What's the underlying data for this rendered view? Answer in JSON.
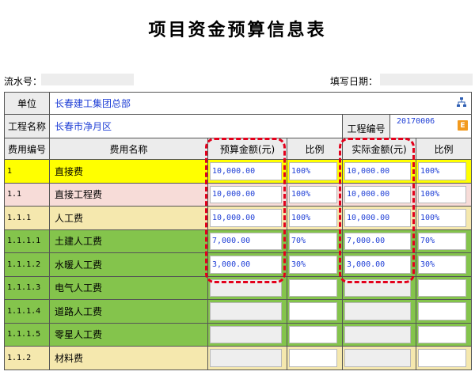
{
  "title": "项目资金预算信息表",
  "meta": {
    "serial_label": "流水号：",
    "serial_value": "",
    "date_label": "填写日期：",
    "date_value": ""
  },
  "unit_row": {
    "label": "单位",
    "value": "长春建工集团总部"
  },
  "project_row": {
    "name_label": "工程名称",
    "name_value": "长春市净月区",
    "code_label": "工程编号",
    "code_value": "20170006"
  },
  "columns": {
    "code": "费用编号",
    "name": "费用名称",
    "budget": "预算金额(元)",
    "budget_ratio": "比例",
    "actual": "实际金额(元)",
    "actual_ratio": "比例"
  },
  "rows": [
    {
      "code": "1",
      "name": "直接费",
      "budget": "10,000.00",
      "budget_ratio": "100%",
      "actual": "10,000.00",
      "actual_ratio": "100%",
      "bg": "#ffff00"
    },
    {
      "code": "1.1",
      "name": "直接工程费",
      "budget": "10,000.00",
      "budget_ratio": "100%",
      "actual": "10,000.00",
      "actual_ratio": "100%",
      "bg": "#f7dcd8"
    },
    {
      "code": "1.1.1",
      "name": "人工费",
      "budget": "10,000.00",
      "budget_ratio": "100%",
      "actual": "10,000.00",
      "actual_ratio": "100%",
      "bg": "#f5e8ae"
    },
    {
      "code": "1.1.1.1",
      "name": "土建人工费",
      "budget": "7,000.00",
      "budget_ratio": "70%",
      "actual": "7,000.00",
      "actual_ratio": "70%",
      "bg": "#84c44c"
    },
    {
      "code": "1.1.1.2",
      "name": "水暖人工费",
      "budget": "3,000.00",
      "budget_ratio": "30%",
      "actual": "3,000.00",
      "actual_ratio": "30%",
      "bg": "#84c44c"
    },
    {
      "code": "1.1.1.3",
      "name": "电气人工费",
      "budget": "",
      "budget_ratio": "",
      "actual": "",
      "actual_ratio": "",
      "bg": "#84c44c"
    },
    {
      "code": "1.1.1.4",
      "name": "道路人工费",
      "budget": "",
      "budget_ratio": "",
      "actual": "",
      "actual_ratio": "",
      "bg": "#84c44c"
    },
    {
      "code": "1.1.1.5",
      "name": "零星人工费",
      "budget": "",
      "budget_ratio": "",
      "actual": "",
      "actual_ratio": "",
      "bg": "#84c44c"
    },
    {
      "code": "1.1.2",
      "name": "材料费",
      "budget": "",
      "budget_ratio": "",
      "actual": "",
      "actual_ratio": "",
      "bg": "#f5e8ae"
    }
  ]
}
